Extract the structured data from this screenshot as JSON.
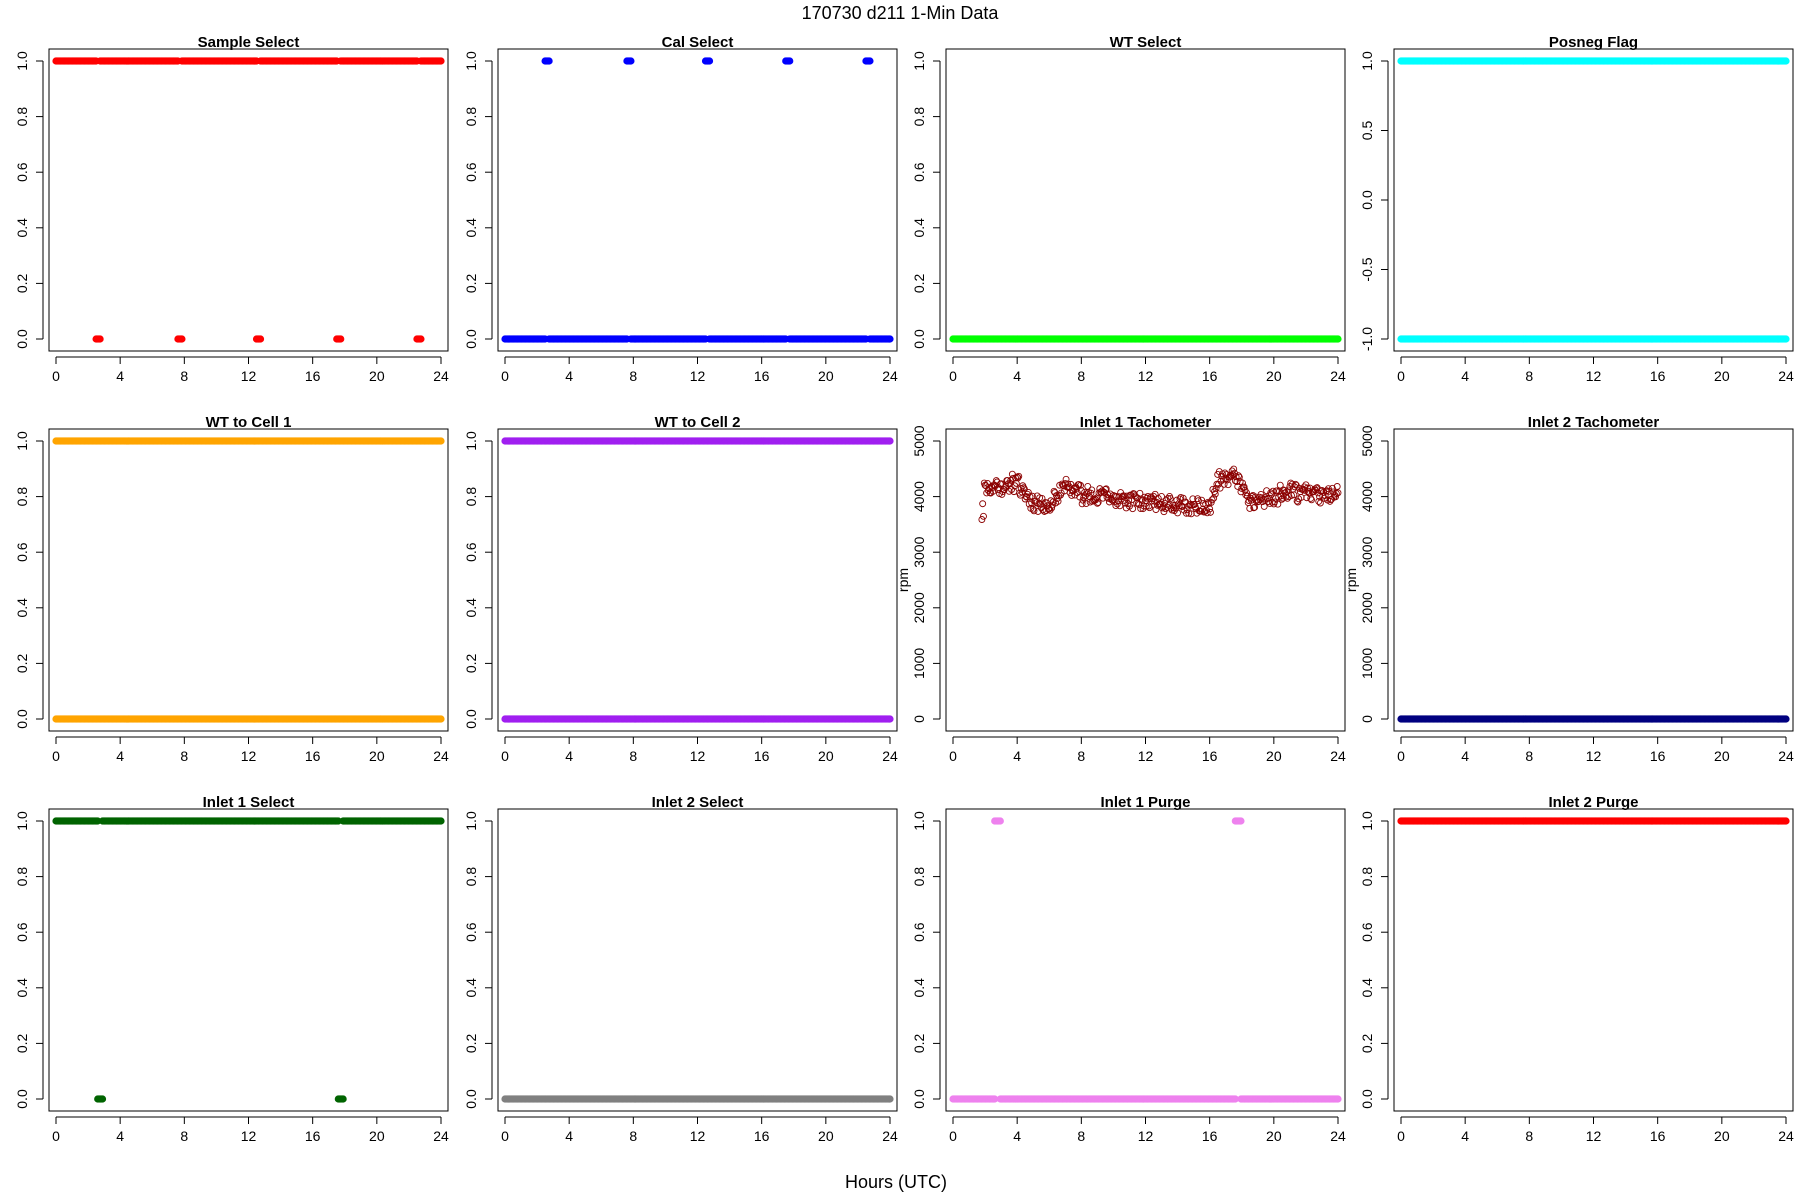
{
  "page": {
    "title": "170730    d211    1-Min Data",
    "xlabel": "Hours (UTC)"
  },
  "chart_data": [
    {
      "type": "scatter",
      "title": "Sample Select",
      "color": "#ff0000",
      "marker": "filled",
      "ylabel": "",
      "xlim": [
        0,
        24
      ],
      "ylim": [
        0,
        1
      ],
      "xticks": [
        0,
        4,
        8,
        12,
        16,
        20,
        24
      ],
      "yticks": [
        0.0,
        0.2,
        0.4,
        0.6,
        0.8,
        1.0
      ],
      "ytick_labels": [
        "0.0",
        "0.2",
        "0.4",
        "0.6",
        "0.8",
        "1.0"
      ],
      "series": [
        {
          "y": 1,
          "segments": [
            [
              0,
              2.5
            ],
            [
              2.75,
              7.6
            ],
            [
              7.85,
              12.5
            ],
            [
              12.75,
              17.5
            ],
            [
              17.75,
              22.5
            ],
            [
              22.75,
              24
            ]
          ]
        },
        {
          "y": 0,
          "segments": [
            [
              2.5,
              2.75
            ],
            [
              7.6,
              7.85
            ],
            [
              12.5,
              12.75
            ],
            [
              17.5,
              17.75
            ],
            [
              22.5,
              22.75
            ]
          ]
        }
      ]
    },
    {
      "type": "scatter",
      "title": "Cal Select",
      "color": "#0000ff",
      "marker": "filled",
      "ylabel": "",
      "xlim": [
        0,
        24
      ],
      "ylim": [
        0,
        1
      ],
      "xticks": [
        0,
        4,
        8,
        12,
        16,
        20,
        24
      ],
      "yticks": [
        0.0,
        0.2,
        0.4,
        0.6,
        0.8,
        1.0
      ],
      "ytick_labels": [
        "0.0",
        "0.2",
        "0.4",
        "0.6",
        "0.8",
        "1.0"
      ],
      "series": [
        {
          "y": 1,
          "segments": [
            [
              2.5,
              2.75
            ],
            [
              7.6,
              7.85
            ],
            [
              12.5,
              12.75
            ],
            [
              17.5,
              17.75
            ],
            [
              22.5,
              22.75
            ]
          ]
        },
        {
          "y": 0,
          "segments": [
            [
              0,
              2.5
            ],
            [
              2.75,
              7.6
            ],
            [
              7.85,
              12.5
            ],
            [
              12.75,
              17.5
            ],
            [
              17.75,
              22.5
            ],
            [
              22.75,
              24
            ]
          ]
        }
      ]
    },
    {
      "type": "scatter",
      "title": "WT Select",
      "color": "#00ff00",
      "marker": "filled",
      "ylabel": "",
      "xlim": [
        0,
        24
      ],
      "ylim": [
        0,
        1
      ],
      "xticks": [
        0,
        4,
        8,
        12,
        16,
        20,
        24
      ],
      "yticks": [
        0.0,
        0.2,
        0.4,
        0.6,
        0.8,
        1.0
      ],
      "ytick_labels": [
        "0.0",
        "0.2",
        "0.4",
        "0.6",
        "0.8",
        "1.0"
      ],
      "series": [
        {
          "y": 0,
          "segments": [
            [
              0,
              24
            ]
          ]
        }
      ]
    },
    {
      "type": "scatter",
      "title": "Posneg Flag",
      "color": "#00ffff",
      "marker": "filled",
      "ylabel": "",
      "xlim": [
        0,
        24
      ],
      "ylim": [
        -1,
        1
      ],
      "xticks": [
        0,
        4,
        8,
        12,
        16,
        20,
        24
      ],
      "yticks": [
        -1.0,
        -0.5,
        0.0,
        0.5,
        1.0
      ],
      "ytick_labels": [
        "-1.0",
        "-0.5",
        "0.0",
        "0.5",
        "1.0"
      ],
      "series": [
        {
          "y": 1,
          "segments": [
            [
              0,
              24
            ]
          ]
        },
        {
          "y": -1,
          "segments": [
            [
              0,
              24
            ]
          ]
        }
      ]
    },
    {
      "type": "scatter",
      "title": "WT to Cell 1",
      "color": "#ffa500",
      "marker": "filled",
      "ylabel": "",
      "xlim": [
        0,
        24
      ],
      "ylim": [
        0,
        1
      ],
      "xticks": [
        0,
        4,
        8,
        12,
        16,
        20,
        24
      ],
      "yticks": [
        0.0,
        0.2,
        0.4,
        0.6,
        0.8,
        1.0
      ],
      "ytick_labels": [
        "0.0",
        "0.2",
        "0.4",
        "0.6",
        "0.8",
        "1.0"
      ],
      "series": [
        {
          "y": 1,
          "segments": [
            [
              0,
              24
            ]
          ]
        },
        {
          "y": 0,
          "segments": [
            [
              0,
              24
            ]
          ]
        }
      ]
    },
    {
      "type": "scatter",
      "title": "WT to Cell 2",
      "color": "#a020f0",
      "marker": "filled",
      "ylabel": "",
      "xlim": [
        0,
        24
      ],
      "ylim": [
        0,
        1
      ],
      "xticks": [
        0,
        4,
        8,
        12,
        16,
        20,
        24
      ],
      "yticks": [
        0.0,
        0.2,
        0.4,
        0.6,
        0.8,
        1.0
      ],
      "ytick_labels": [
        "0.0",
        "0.2",
        "0.4",
        "0.6",
        "0.8",
        "1.0"
      ],
      "series": [
        {
          "y": 1,
          "segments": [
            [
              0,
              24
            ]
          ]
        },
        {
          "y": 0,
          "segments": [
            [
              0,
              24
            ]
          ]
        }
      ]
    },
    {
      "type": "scatter",
      "title": "Inlet 1 Tachometer",
      "color": "#8b0000",
      "marker": "open",
      "ylabel": "rpm",
      "xlim": [
        0,
        24
      ],
      "ylim": [
        0,
        5000
      ],
      "xticks": [
        0,
        4,
        8,
        12,
        16,
        20,
        24
      ],
      "yticks": [
        0,
        1000,
        2000,
        3000,
        4000,
        5000
      ],
      "ytick_labels": [
        "0",
        "1000",
        "2000",
        "3000",
        "4000",
        "5000"
      ],
      "scatter": {
        "x_start": 1.8,
        "x_end": 24,
        "step": 0.05,
        "profile": [
          [
            1.8,
            4150
          ],
          [
            3,
            4200
          ],
          [
            4,
            4250
          ],
          [
            5,
            3900
          ],
          [
            6,
            3850
          ],
          [
            7,
            4200
          ],
          [
            8,
            4050
          ],
          [
            10,
            3950
          ],
          [
            12,
            3900
          ],
          [
            14,
            3850
          ],
          [
            16,
            3800
          ],
          [
            16.5,
            4300
          ],
          [
            17.5,
            4350
          ],
          [
            18.5,
            3900
          ],
          [
            20,
            4000
          ],
          [
            21,
            4100
          ],
          [
            22,
            4050
          ],
          [
            24,
            4050
          ]
        ],
        "spread": 140,
        "low_start": 3750
      }
    },
    {
      "type": "scatter",
      "title": "Inlet 2 Tachometer",
      "color": "#000080",
      "marker": "filled",
      "ylabel": "rpm",
      "xlim": [
        0,
        24
      ],
      "ylim": [
        0,
        5000
      ],
      "xticks": [
        0,
        4,
        8,
        12,
        16,
        20,
        24
      ],
      "yticks": [
        0,
        1000,
        2000,
        3000,
        4000,
        5000
      ],
      "ytick_labels": [
        "0",
        "1000",
        "2000",
        "3000",
        "4000",
        "5000"
      ],
      "series": [
        {
          "y": 0,
          "segments": [
            [
              0,
              24
            ]
          ]
        }
      ]
    },
    {
      "type": "scatter",
      "title": "Inlet 1 Select",
      "color": "#006400",
      "marker": "filled",
      "ylabel": "",
      "xlim": [
        0,
        24
      ],
      "ylim": [
        0,
        1
      ],
      "xticks": [
        0,
        4,
        8,
        12,
        16,
        20,
        24
      ],
      "yticks": [
        0.0,
        0.2,
        0.4,
        0.6,
        0.8,
        1.0
      ],
      "ytick_labels": [
        "0.0",
        "0.2",
        "0.4",
        "0.6",
        "0.8",
        "1.0"
      ],
      "series": [
        {
          "y": 1,
          "segments": [
            [
              0,
              2.6
            ],
            [
              2.9,
              17.6
            ],
            [
              17.9,
              24
            ]
          ]
        },
        {
          "y": 0,
          "segments": [
            [
              2.6,
              2.9
            ],
            [
              17.6,
              17.9
            ]
          ]
        }
      ]
    },
    {
      "type": "scatter",
      "title": "Inlet 2 Select",
      "color": "#808080",
      "marker": "filled",
      "ylabel": "",
      "xlim": [
        0,
        24
      ],
      "ylim": [
        0,
        1
      ],
      "xticks": [
        0,
        4,
        8,
        12,
        16,
        20,
        24
      ],
      "yticks": [
        0.0,
        0.2,
        0.4,
        0.6,
        0.8,
        1.0
      ],
      "ytick_labels": [
        "0.0",
        "0.2",
        "0.4",
        "0.6",
        "0.8",
        "1.0"
      ],
      "series": [
        {
          "y": 0,
          "segments": [
            [
              0,
              24
            ]
          ]
        }
      ]
    },
    {
      "type": "scatter",
      "title": "Inlet 1 Purge",
      "color": "#ee82ee",
      "marker": "filled",
      "ylabel": "",
      "xlim": [
        0,
        24
      ],
      "ylim": [
        0,
        1
      ],
      "xticks": [
        0,
        4,
        8,
        12,
        16,
        20,
        24
      ],
      "yticks": [
        0.0,
        0.2,
        0.4,
        0.6,
        0.8,
        1.0
      ],
      "ytick_labels": [
        "0.0",
        "0.2",
        "0.4",
        "0.6",
        "0.8",
        "1.0"
      ],
      "series": [
        {
          "y": 1,
          "segments": [
            [
              2.6,
              2.95
            ],
            [
              17.6,
              17.95
            ]
          ]
        },
        {
          "y": 0,
          "segments": [
            [
              0,
              2.6
            ],
            [
              2.95,
              17.6
            ],
            [
              17.95,
              24
            ]
          ]
        }
      ]
    },
    {
      "type": "scatter",
      "title": "Inlet 2 Purge",
      "color": "#ff0000",
      "marker": "filled",
      "ylabel": "",
      "xlim": [
        0,
        24
      ],
      "ylim": [
        0,
        1
      ],
      "xticks": [
        0,
        4,
        8,
        12,
        16,
        20,
        24
      ],
      "yticks": [
        0.0,
        0.2,
        0.4,
        0.6,
        0.8,
        1.0
      ],
      "ytick_labels": [
        "0.0",
        "0.2",
        "0.4",
        "0.6",
        "0.8",
        "1.0"
      ],
      "series": [
        {
          "y": 1,
          "segments": [
            [
              0,
              24
            ]
          ]
        }
      ]
    }
  ]
}
